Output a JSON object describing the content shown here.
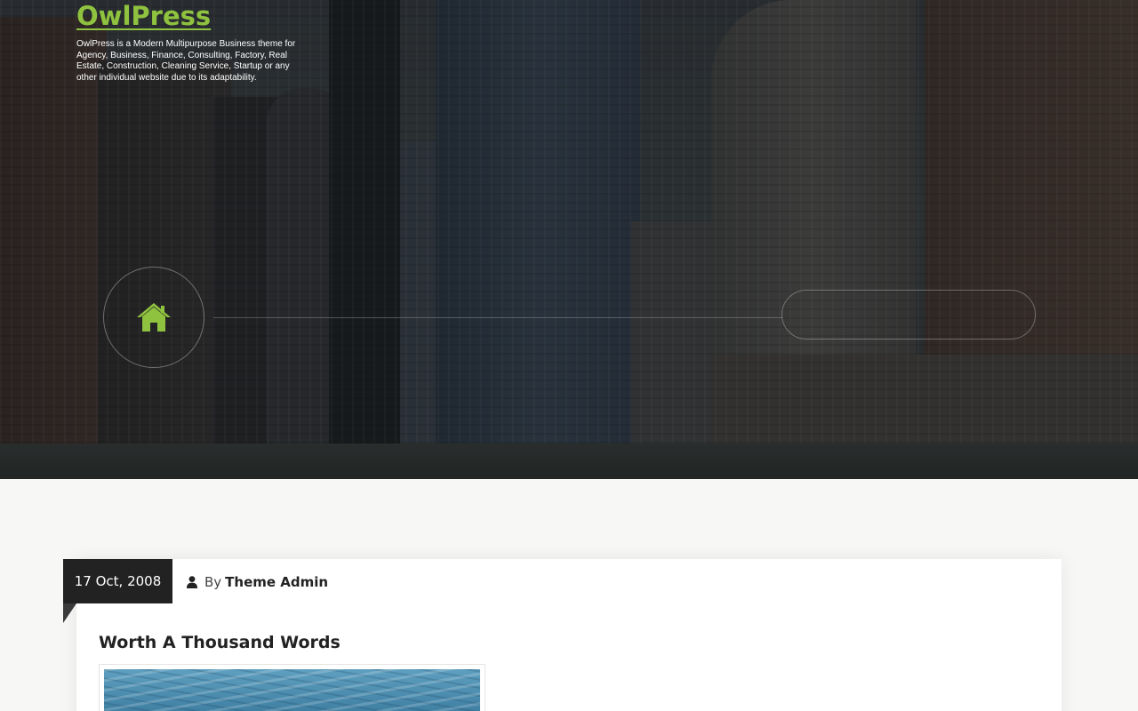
{
  "site": {
    "title": "OwlPress",
    "tagline": "OwlPress is a Modern Multipurpose Business theme for Agency, Business, Finance, Consulting, Factory, Real Estate, Construction, Cleaning Service, Startup or any other individual website due to its adaptability."
  },
  "hero": {
    "home_icon": "home-icon",
    "accent_color": "#8fc23f"
  },
  "post": {
    "date": "17 Oct, 2008",
    "author_prefix": "By",
    "author_icon": "user-icon",
    "author": "Theme Admin",
    "title": "Worth A Thousand Words"
  }
}
